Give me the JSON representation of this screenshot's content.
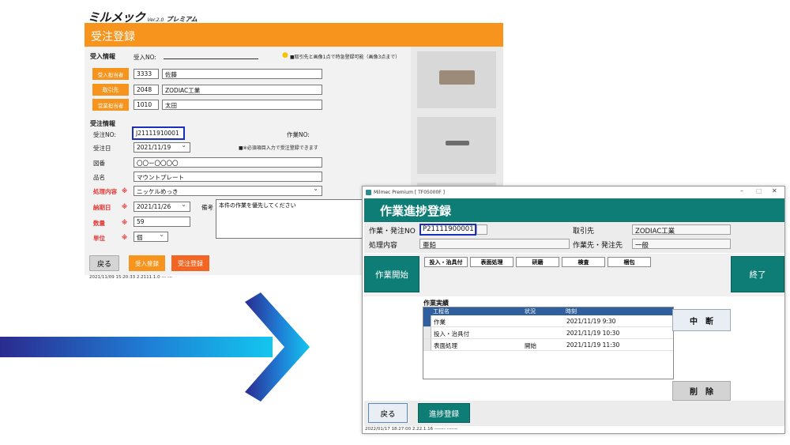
{
  "order_form": {
    "logo": {
      "main": "ミルメック",
      "version": "Ver.2.0",
      "edition": "プレミアム"
    },
    "title": "受注登録",
    "receipt_section": "受入情報",
    "receipt_no_label": "受入NO:",
    "notice": "■取引先と画像1点で特急登録可能（画像3点まで）",
    "receiver_btn": "受入担当者",
    "receiver_code": "3333",
    "receiver_name": "佐藤",
    "client_btn": "取引先",
    "client_code": "2048",
    "client_name": "ZODIAC工業",
    "sales_btn": "営業担当者",
    "sales_code": "1010",
    "sales_name": "太田",
    "order_section": "受注情報",
    "order_no_label": "受注NO:",
    "order_no": "J21111910001",
    "work_no_label": "作業NO:",
    "order_date_label": "受注日",
    "order_date": "2021/11/19",
    "required_notice": "■※必須項目入力で受注登録できます",
    "drawing_label": "図番",
    "drawing_value": "〇〇ー〇〇〇〇",
    "product_label": "品名",
    "product_value": "マウントプレート",
    "process_label": "処理内容",
    "process_value": "ニッケルめっき",
    "due_label": "納期日",
    "due_value": "2021/11/26",
    "memo_label": "備考",
    "memo_value": "本件の作業を優先してください",
    "qty_label": "数量",
    "qty_value": "59",
    "unit_label": "単位",
    "unit_value": "個",
    "required_mark": "※",
    "back_btn": "戻る",
    "receipt_reg_btn": "受入登録",
    "order_reg_btn": "受注登録",
    "status": "2021/11/09 15:20:33 2.2111.1.0  ---  ---"
  },
  "progress_form": {
    "window_title": "Milmec Premium [ TF05000F ]",
    "title": "作業進捗登録",
    "work_order_label": "作業・発注NO",
    "work_order_no": "P21111900001",
    "client_label": "取引先",
    "client_value": "ZODIAC工業",
    "process_label": "処理内容",
    "process_value": "亜鉛",
    "work_dest_label": "作業先・発注先",
    "work_dest_value": "一般",
    "start_btn": "作業開始",
    "end_btn": "終了",
    "steps": [
      "投入・治具付",
      "表面処理",
      "研磨",
      "検査",
      "梱包"
    ],
    "results_label": "作業実績",
    "grid_headers": [
      "工程名",
      "状況",
      "時刻"
    ],
    "grid_rows": [
      {
        "process": "作業",
        "status": "",
        "time": "2021/11/19 9:30"
      },
      {
        "process": "投入・治具付",
        "status": "",
        "time": "2021/11/19 10:30"
      },
      {
        "process": "表面処理",
        "status": "開始",
        "time": "2021/11/19 11:30"
      }
    ],
    "pause_btn": "中　断",
    "delete_btn": "削　除",
    "back_btn": "戻る",
    "register_btn": "進捗登録",
    "status": "2022/01/17 18:27:00 2.22.1.16  ------- -------"
  },
  "colors": {
    "orange": "#f7941d",
    "teal": "#0e7d76",
    "highlight": "#1b2fbd",
    "required": "#e53935"
  }
}
